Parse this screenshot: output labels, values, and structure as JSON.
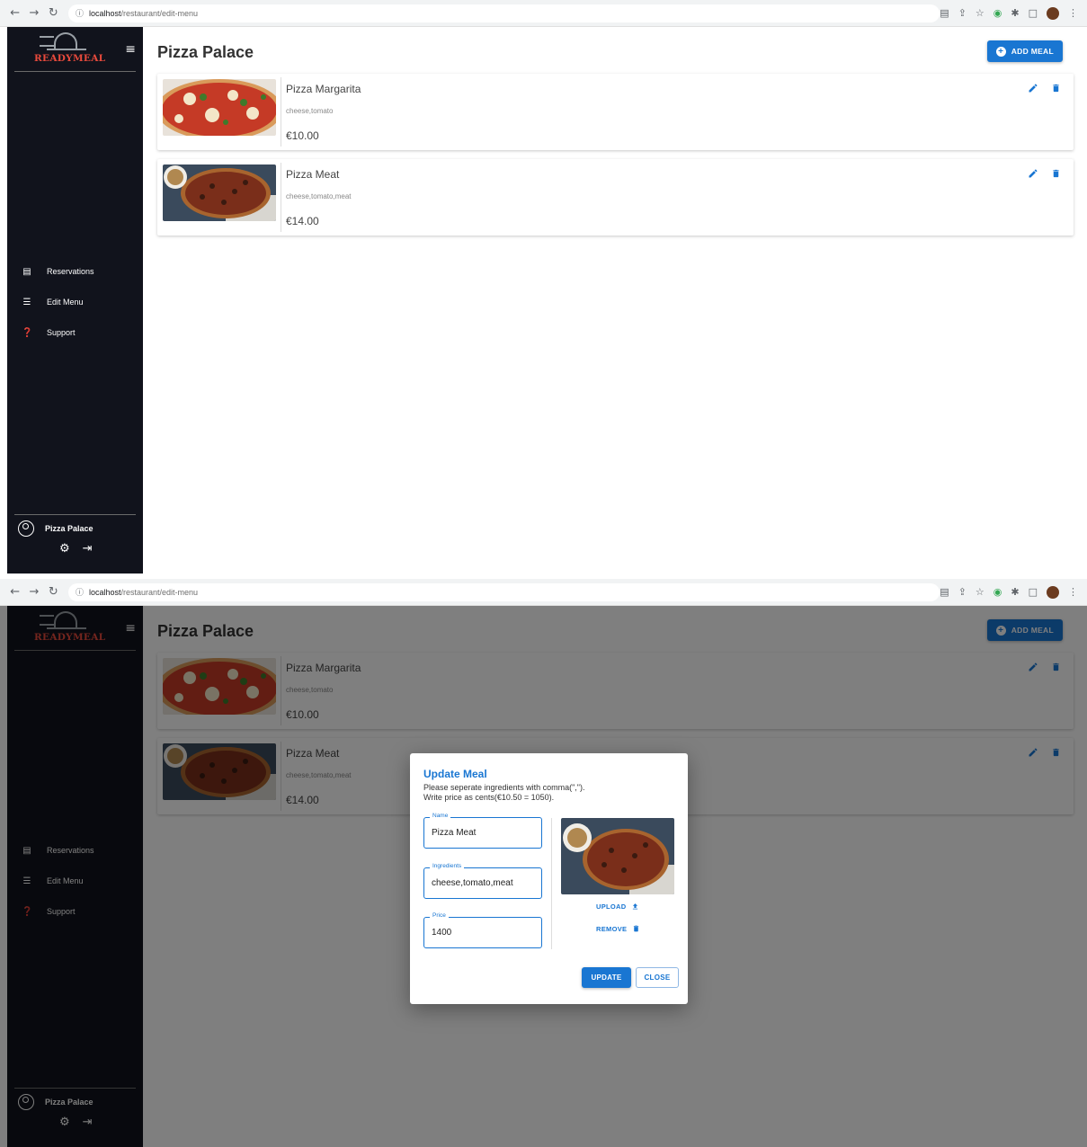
{
  "browser": {
    "url_host": "localhost",
    "url_path": "/restaurant/edit-menu"
  },
  "sidebar": {
    "logo_text": "READYMEAL",
    "items": [
      {
        "label": "Reservations",
        "icon": "book-icon"
      },
      {
        "label": "Edit Menu",
        "icon": "list-icon"
      },
      {
        "label": "Support",
        "icon": "help-icon"
      }
    ],
    "user_name": "Pizza Palace"
  },
  "main": {
    "title": "Pizza Palace",
    "add_button_label": "ADD MEAL",
    "meals": [
      {
        "name": "Pizza Margarita",
        "ingredients": "cheese,tomato",
        "price": "€10.00"
      },
      {
        "name": "Pizza Meat",
        "ingredients": "cheese,tomato,meat",
        "price": "€14.00"
      }
    ]
  },
  "dialog": {
    "title": "Update Meal",
    "desc_line1": "Please seperate ingredients with comma(\",\").",
    "desc_line2": "Write price as cents(€10.50 = 1050).",
    "name_label": "Name",
    "name_value": "Pizza Meat",
    "ingredients_label": "Ingredients",
    "ingredients_value": "cheese,tomato,meat",
    "price_label": "Price",
    "price_value": "1400",
    "upload_label": "UPLOAD",
    "remove_label": "REMOVE",
    "update_label": "UPDATE",
    "close_label": "CLOSE"
  },
  "colors": {
    "primary": "#1976d2",
    "sidebar_bg": "#11131c",
    "logo_red": "#e84a3c"
  }
}
